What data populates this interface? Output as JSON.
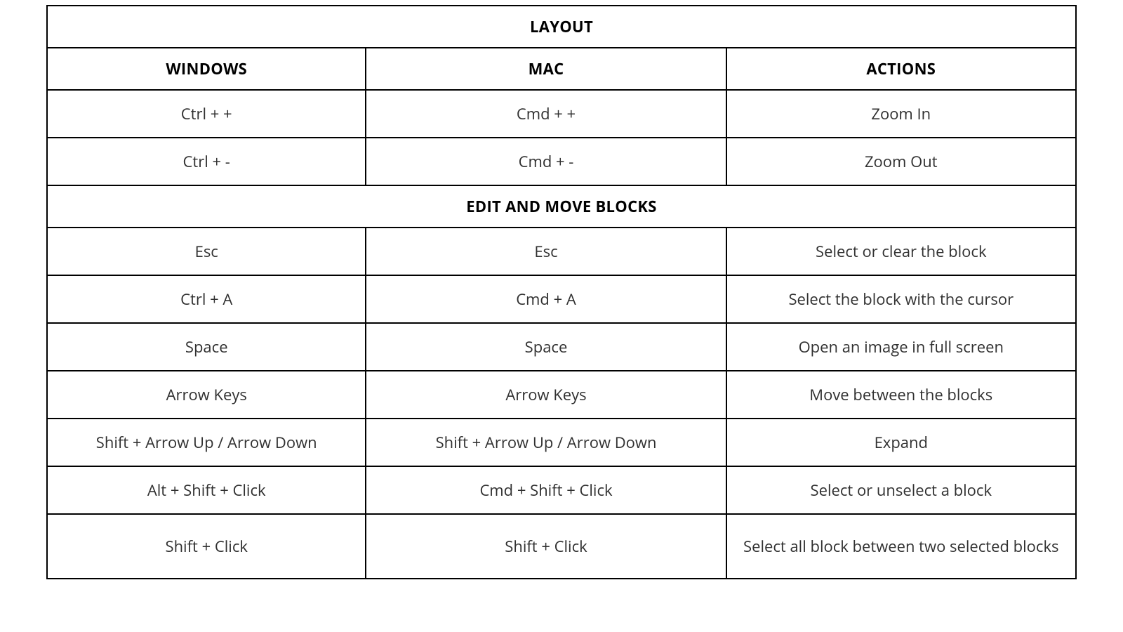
{
  "sections": {
    "layout": {
      "title": "LAYOUT",
      "headers": {
        "windows": "WINDOWS",
        "mac": "MAC",
        "actions": "ACTIONS"
      },
      "rows": [
        {
          "windows": "Ctrl + +",
          "mac": "Cmd + +",
          "action": "Zoom In"
        },
        {
          "windows": "Ctrl + -",
          "mac": "Cmd + -",
          "action": "Zoom Out"
        }
      ]
    },
    "edit_move": {
      "title": "EDIT AND MOVE BLOCKS",
      "rows": [
        {
          "windows": "Esc",
          "mac": "Esc",
          "action": "Select or clear the block"
        },
        {
          "windows": "Ctrl + A",
          "mac": "Cmd + A",
          "action": "Select the block with the cursor"
        },
        {
          "windows": "Space",
          "mac": "Space",
          "action": "Open an image in full screen"
        },
        {
          "windows": "Arrow Keys",
          "mac": "Arrow Keys",
          "action": "Move between the blocks"
        },
        {
          "windows": "Shift + Arrow Up / Arrow Down",
          "mac": "Shift + Arrow Up / Arrow Down",
          "action": "Expand"
        },
        {
          "windows": "Alt + Shift + Click",
          "mac": "Cmd + Shift + Click",
          "action": "Select or unselect a block"
        },
        {
          "windows": "Shift + Click",
          "mac": "Shift + Click",
          "action": "Select all block between two selected blocks"
        }
      ]
    }
  }
}
